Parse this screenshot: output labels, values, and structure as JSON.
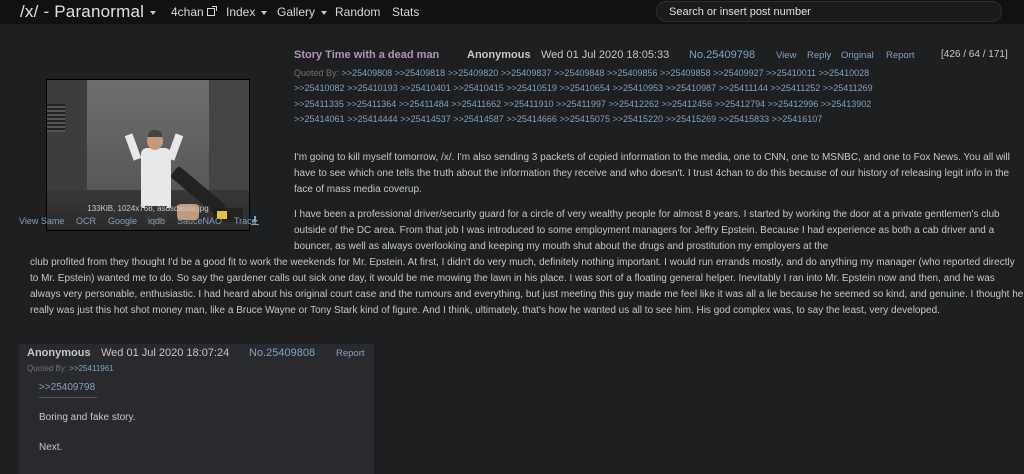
{
  "nav": {
    "board_title": "/x/ - Paranormal",
    "links": {
      "fourchan": "4chan",
      "index": "Index",
      "gallery": "Gallery",
      "random": "Random",
      "stats": "Stats"
    },
    "search_placeholder": "Search or insert post number"
  },
  "op": {
    "subject": "Story Time with a dead man",
    "name": "Anonymous",
    "date": "Wed 01 Jul 2020 18:05:33",
    "post_no": "No.25409798",
    "actions": {
      "view": "View",
      "reply": "Reply",
      "original": "Original",
      "report": "Report"
    },
    "stats": "[426 / 64 / 171]",
    "quoted_by_label": "Quoted By:",
    "quoted_by": [
      ">>25409808",
      ">>25409818",
      ">>25409820",
      ">>25409837",
      ">>25409848",
      ">>25409856",
      ">>25409858",
      ">>25409927",
      ">>25410011",
      ">>25410028",
      ">>25410082",
      ">>25410193",
      ">>25410401",
      ">>25410415",
      ">>25410519",
      ">>25410654",
      ">>25410953",
      ">>25410987",
      ">>25411144",
      ">>25411252",
      ">>25411269",
      ">>25411335",
      ">>25411364",
      ">>25411484",
      ">>25411662",
      ">>25411910",
      ">>25411997",
      ">>25412262",
      ">>25412456",
      ">>25412794",
      ">>25412996",
      ">>25413902",
      ">>25414061",
      ">>25414444",
      ">>25414537",
      ">>25414587",
      ">>25414666",
      ">>25415075",
      ">>25415220",
      ">>25415269",
      ">>25415833",
      ">>25416107"
    ],
    "file_info": "133KiB, 1024x768, asdsdasda.jpg",
    "image_links": {
      "view_same": "View Same",
      "ocr": "OCR",
      "google": "Google",
      "iqdb": "iqdb",
      "saucenao": "SauceNAO",
      "trace": "Trace"
    },
    "body_p1": "I'm going to kill myself tomorrow, /x/. I'm also sending 3 packets of copied information to the media, one to CNN, one to MSNBC, and one to Fox News. You all will have to see which one tells the truth about the information they receive and who doesn't. I trust 4chan to do this because of our history of releasing legit info in the face of mass media coverup.",
    "body_p2_first": "I have been a professional driver/security guard for a circle of very wealthy people for almost 8 years. I started by working the door at a private gentlemen's club outside of the DC area. From that job I was introduced to some employment managers for Jeffry Epstein. Because I had experience as both a cab driver and a bouncer, as well as always overlooking and keeping my mouth shut about the drugs and prostitution my employers at the",
    "body_p2_rest": "club profited from they thought I'd be a good fit to work the weekends for Mr. Epstein. At first, I didn't do very much, definitely nothing important. I would run errands mostly, and do anything my manager (who reported directly to Mr. Epstein) wanted me to do. So say the gardener calls out sick one day, it would be me mowing the lawn in his place. I was sort of a floating general helper. Inevitably I ran into Mr. Epstein now and then, and he was always very personable, enthusiastic. I had heard about his original court case and the rumours and everything, but just meeting this guy made me feel like it was all a lie because he seemed so kind, and genuine. I thought he really was just this hot shot money man, like a Bruce Wayne or Tony Stark kind of figure. And I think, ultimately, that's how he wanted us all to see him. His god complex was, to say the least, very developed."
  },
  "reply": {
    "name": "Anonymous",
    "date": "Wed 01 Jul 2020 18:07:24",
    "post_no": "No.25409808",
    "report": "Report",
    "quoted_by_label": "Quoted By:",
    "quoted_by": ">>25411961",
    "quote_link": ">>25409798",
    "text1": "Boring and fake story.",
    "text2": "Next."
  },
  "colors": {
    "background": "#1d1f21",
    "link": "#81a2be",
    "subject": "#b294bb",
    "post_bg": "#282a2e"
  }
}
